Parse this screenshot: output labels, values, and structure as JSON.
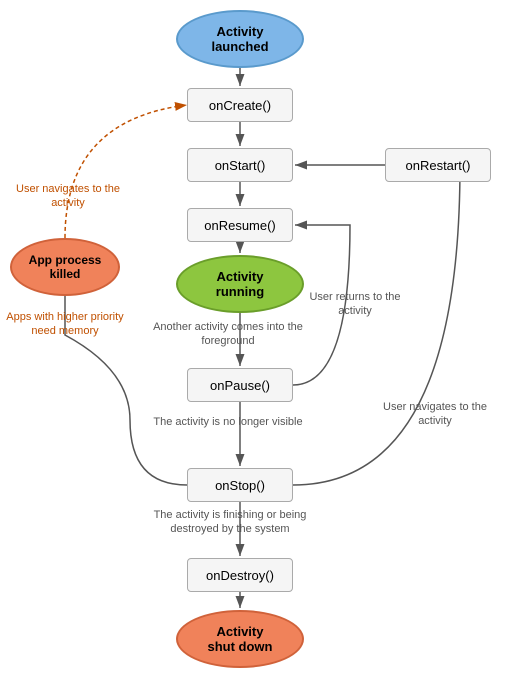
{
  "nodes": {
    "activity_launched": "Activity\nlaunched",
    "oncreate": "onCreate()",
    "onstart": "onStart()",
    "onresume": "onResume()",
    "activity_running": "Activity\nrunning",
    "onpause": "onPause()",
    "onstop": "onStop()",
    "ondestroy": "onDestroy()",
    "activity_shutdown": "Activity\nshut down",
    "app_process_killed": "App process\nkilled",
    "onrestart": "onRestart()"
  },
  "labels": {
    "user_navigates_to_activity": "User navigates\nto the activity",
    "apps_higher_priority": "Apps with higher priority\nneed memory",
    "another_activity": "Another activity comes\ninto the foreground",
    "user_returns": "User returns\nto the activity",
    "no_longer_visible": "The activity is\nno longer visible",
    "user_navigates_to_activity2": "User navigates\nto the activity",
    "finishing_or_destroyed": "The activity is finishing or\nbeing destroyed by the system"
  }
}
